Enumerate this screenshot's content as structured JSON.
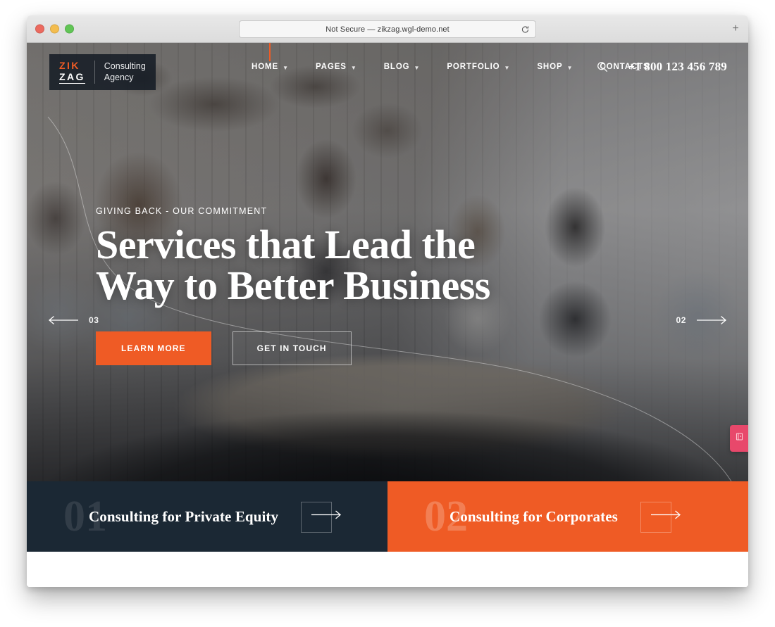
{
  "browser": {
    "address_text": "Not Secure — zikzag.wgl-demo.net",
    "reload_icon": "reload-icon",
    "new_tab_label": "+",
    "traffic_lights": [
      "close",
      "minimize",
      "zoom"
    ]
  },
  "site": {
    "logo": {
      "zik": "ZIK",
      "zag": "ZAG",
      "tagline_line1": "Consulting",
      "tagline_line2": "Agency"
    },
    "nav": [
      {
        "label": "HOME",
        "has_dropdown": true,
        "active": true
      },
      {
        "label": "PAGES",
        "has_dropdown": true,
        "active": false
      },
      {
        "label": "BLOG",
        "has_dropdown": true,
        "active": false
      },
      {
        "label": "PORTFOLIO",
        "has_dropdown": true,
        "active": false
      },
      {
        "label": "SHOP",
        "has_dropdown": true,
        "active": false
      },
      {
        "label": "CONTACTS",
        "has_dropdown": false,
        "active": false
      }
    ],
    "search_icon": "search-icon",
    "phone": "+1 800 123 456 789"
  },
  "hero": {
    "subtitle": "GIVING BACK - OUR COMMITMENT",
    "title": "Services that Lead the\nWay to Better Business",
    "primary_button": "LEARN MORE",
    "secondary_button": "GET IN TOUCH",
    "slider": {
      "prev_number": "03",
      "next_number": "02",
      "prev_icon": "arrow-left-icon",
      "next_icon": "arrow-right-icon"
    }
  },
  "side_widget": {
    "icon": "book-icon",
    "color": "#e8486b"
  },
  "promo_cards": [
    {
      "number": "01",
      "title": "Consulting for Private Equity",
      "arrow_icon": "arrow-right-icon",
      "background": "#1b2834"
    },
    {
      "number": "02",
      "title": "Consulting for Corporates",
      "arrow_icon": "arrow-right-icon",
      "background": "#ef5b25"
    }
  ],
  "colors": {
    "accent_orange": "#ef5b25",
    "dark_navy": "#1b2834",
    "widget_pink": "#e8486b"
  }
}
